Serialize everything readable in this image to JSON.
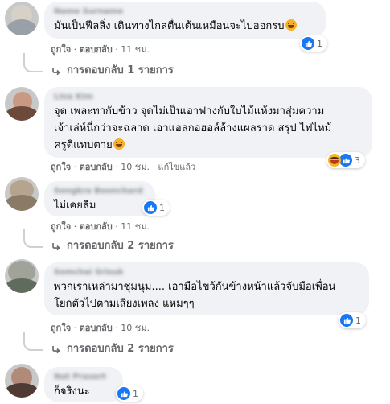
{
  "comments": [
    {
      "author": "Name Surname",
      "lines": [
        "มันเป็นฟีลลิ่ง เดินทางไกลตื่นเต้นเหมือนจะไปออกรบ"
      ],
      "reaction_count": "1",
      "like": "ถูกใจ",
      "reply": "ตอบกลับ",
      "time": "11 ชม.",
      "replies_label": "การตอบกลับ 1 รายการ"
    },
    {
      "author": "Lina Kim",
      "lines": [
        "จุด เพละทากับข้าว จุดไม่เป็นเอาฟางกับใบไม้แห้งมาสุ่มความ",
        "เจ้าเล่ห์นี่กว่าจะฉลาด เอาแอลกอฮอล์ล้างแผลราด สรุป ไฟไหม้",
        "ครูตีแทบตาย"
      ],
      "reaction_count": "3",
      "like": "ถูกใจ",
      "reply": "ตอบกลับ",
      "time": "10 ชม.",
      "edited": "แก้ไขแล้ว"
    },
    {
      "author": "Songkra Boonchard",
      "lines": [
        "ไม่เคยลืม"
      ],
      "reaction_count": "1",
      "like": "ถูกใจ",
      "reply": "ตอบกลับ",
      "time": "11 ชม.",
      "replies_label": "การตอบกลับ 2 รายการ"
    },
    {
      "author": "Somchai Srisuk",
      "lines": [
        "พวกเราเหล่ามาชุมนุม.... เอามือไขว้กันข้างหน้าแล้วจับมือเพื่อน",
        "โยกตัวไปตามเสียงเพลง แหมๆๆ"
      ],
      "reaction_count": "1",
      "like": "ถูกใจ",
      "reply": "ตอบกลับ",
      "time": "10 ชม.",
      "replies_label": "การตอบกลับ 2 รายการ"
    },
    {
      "author": "Nat Prasert",
      "lines": [
        "ก็จริงนะ"
      ],
      "reaction_count": "1"
    }
  ],
  "colors": {
    "bubble": "#f0f2f5",
    "meta_text": "#65676b",
    "like_blue": "#1877f2",
    "emoji_yellow": "#f7b125"
  },
  "icons": [
    "like-icon",
    "haha-icon",
    "reply-arrow-icon",
    "laughing-emoji-icon",
    "grinning-emoji-icon"
  ]
}
